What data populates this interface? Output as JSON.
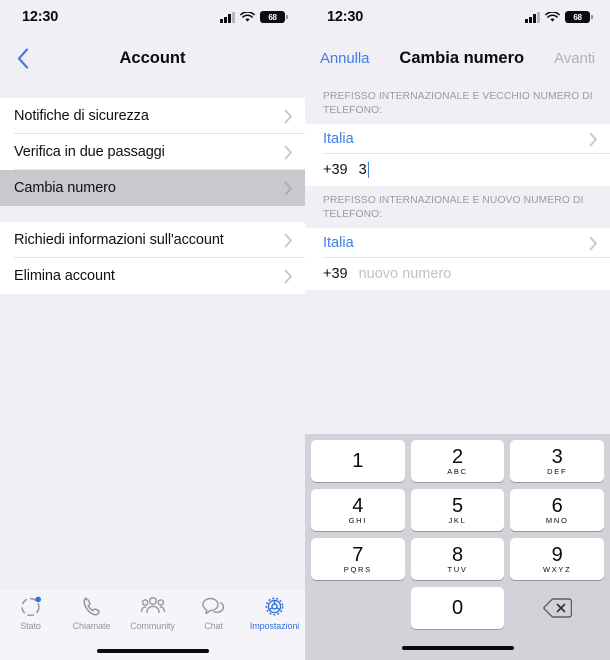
{
  "status_bar": {
    "time": "12:30",
    "battery_level": "68",
    "signal_icon": "cellular-signal-icon",
    "wifi_icon": "wifi-icon",
    "battery_icon": "battery-icon"
  },
  "colors": {
    "accent_blue": "#3f7fe0",
    "tab_active_blue": "#2f72d8",
    "selected_row_gray": "#c9c8ce",
    "page_background": "#f0eff5",
    "keypad_background": "#d2d2d8",
    "disabled_gray": "#b3b2ba"
  },
  "left_screen": {
    "back_icon": "chevron-left-icon",
    "title": "Account",
    "group_one": [
      {
        "label": "Notifiche di sicurezza",
        "selected": false
      },
      {
        "label": "Verifica in due passaggi",
        "selected": false
      },
      {
        "label": "Cambia numero",
        "selected": true
      }
    ],
    "group_two": [
      {
        "label": "Richiedi informazioni sull'account",
        "selected": false
      },
      {
        "label": "Elimina account",
        "selected": false
      }
    ],
    "tabs": [
      {
        "label": "Stato",
        "icon": "status-ring-icon",
        "active": false,
        "badge": true
      },
      {
        "label": "Chiamate",
        "icon": "phone-icon",
        "active": false,
        "badge": false
      },
      {
        "label": "Community",
        "icon": "community-icon",
        "active": false,
        "badge": false
      },
      {
        "label": "Chat",
        "icon": "chat-bubble-icon",
        "active": false,
        "badge": false
      },
      {
        "label": "Impostazioni",
        "icon": "gear-icon",
        "active": true,
        "badge": false
      }
    ]
  },
  "right_screen": {
    "cancel_label": "Annulla",
    "title": "Cambia numero",
    "next_label": "Avanti",
    "section_old": {
      "header": "PREFISSO INTERNAZIONALE E VECCHIO NUMERO DI TELEFONO:",
      "country": "Italia",
      "prefix": "+39",
      "number_value": "3",
      "number_placeholder": ""
    },
    "section_new": {
      "header": "PREFISSO INTERNAZIONALE E NUOVO NUMERO DI TELEFONO:",
      "country": "Italia",
      "prefix": "+39",
      "number_value": "",
      "number_placeholder": "nuovo numero"
    },
    "keypad": {
      "keys": [
        {
          "num": "1",
          "letters": ""
        },
        {
          "num": "2",
          "letters": "ABC"
        },
        {
          "num": "3",
          "letters": "DEF"
        },
        {
          "num": "4",
          "letters": "GHI"
        },
        {
          "num": "5",
          "letters": "JKL"
        },
        {
          "num": "6",
          "letters": "MNO"
        },
        {
          "num": "7",
          "letters": "PQRS"
        },
        {
          "num": "8",
          "letters": "TUV"
        },
        {
          "num": "9",
          "letters": "WXYZ"
        },
        {
          "num": "0",
          "letters": ""
        }
      ],
      "delete_icon": "backspace-delete-icon"
    }
  }
}
